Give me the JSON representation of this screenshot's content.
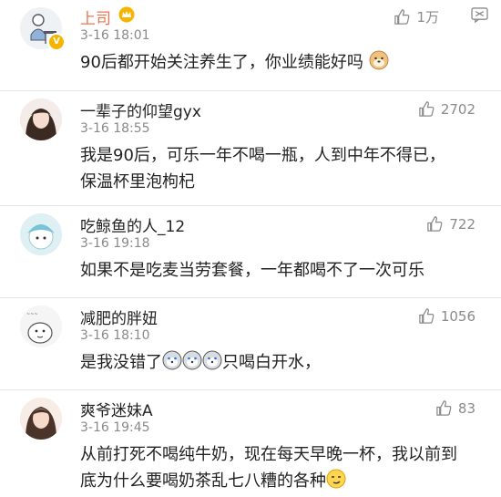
{
  "comments": [
    {
      "name": "上司",
      "time": "3-16 18:01",
      "likes": "1万",
      "text": [
        "90后都开始关注养生了，你业绩能好吗"
      ]
    },
    {
      "name": "一辈子的仰望gyx",
      "time": "3-16 18:55",
      "likes": "2702",
      "text": [
        "我是90后，可乐一年不喝一瓶，人到中年不得已，",
        "保温杯里泡枸杞"
      ]
    },
    {
      "name": "吃鲸鱼的人_12",
      "time": "3-16 19:18",
      "likes": "722",
      "text": [
        "如果不是吃麦当劳套餐，一年都喝不了一次可乐"
      ]
    },
    {
      "name": "减肥的胖妞",
      "time": "3-16 18:10",
      "likes": "1056",
      "text": [
        "是我没错了",
        "只喝白开水，"
      ]
    },
    {
      "name": "爽爷迷妹A",
      "time": "3-16 19:45",
      "likes": "83",
      "text": [
        "从前打死不喝纯牛奶，现在每天早晚一杯，我以前到",
        "底为什么要喝奶茶乱七八糟的各种"
      ]
    }
  ],
  "colors": {
    "vip_name": "#eb7350",
    "meta": "#8a8a8a",
    "badge": "#f4b400"
  }
}
